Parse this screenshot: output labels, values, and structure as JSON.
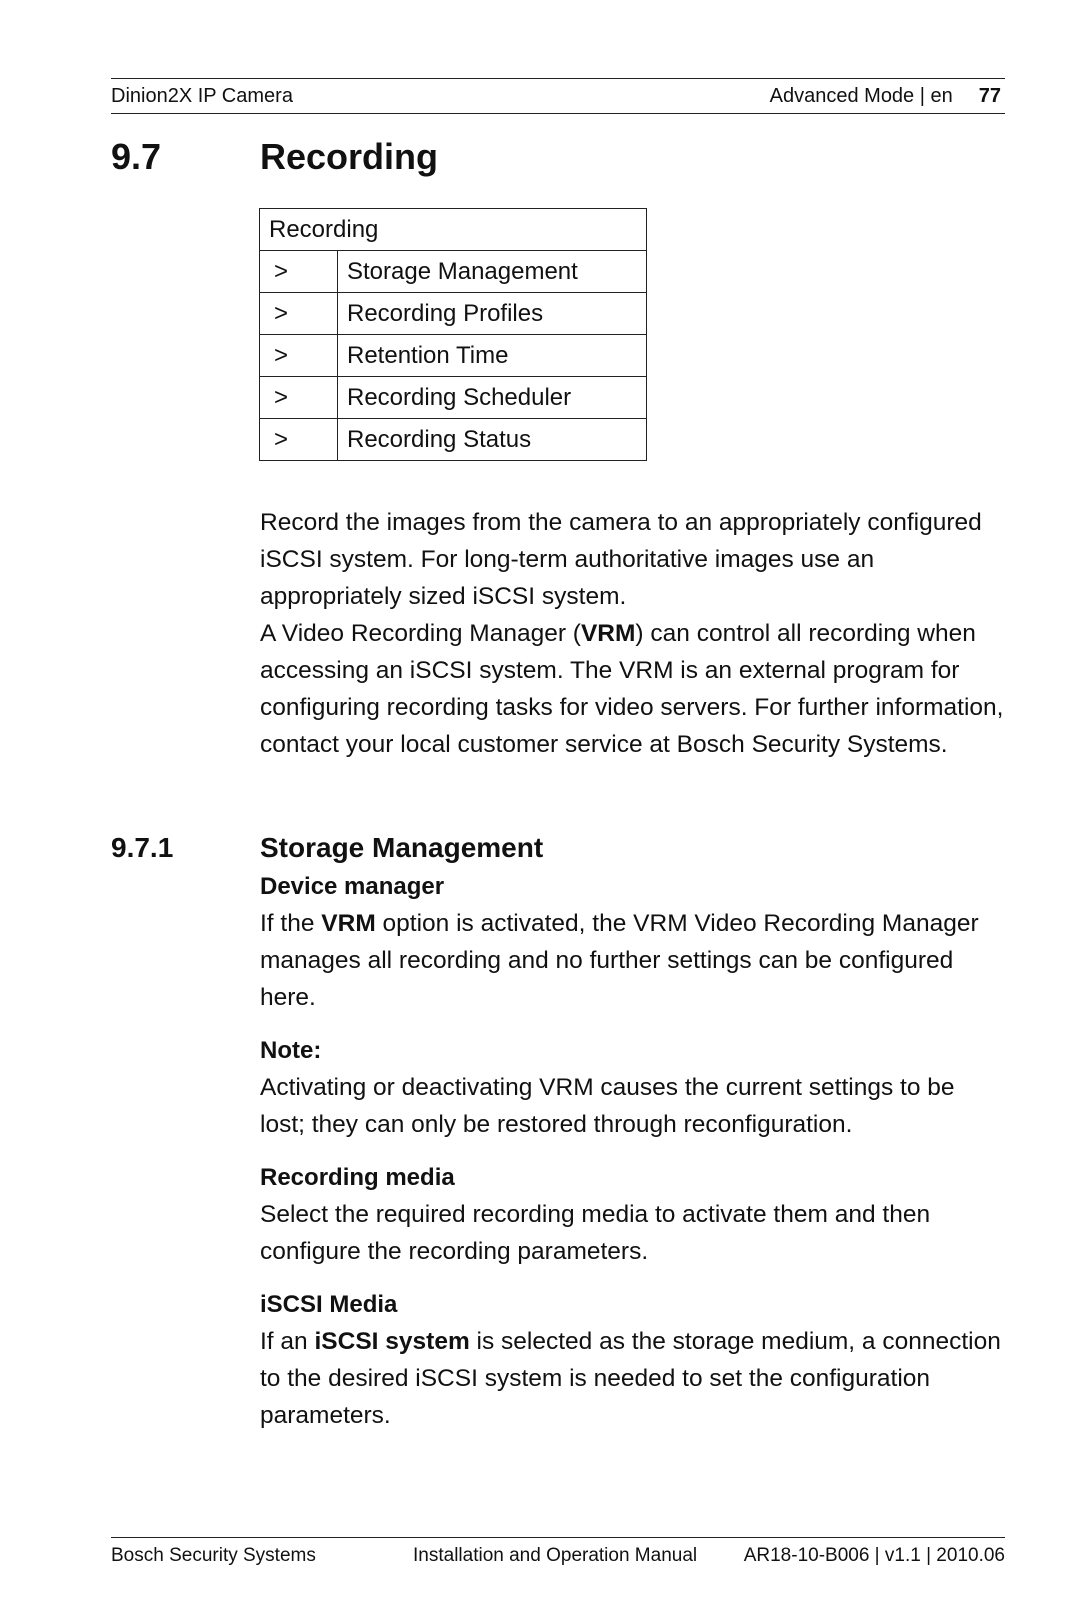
{
  "header": {
    "product": "Dinion2X IP Camera",
    "section": "Advanced Mode | en",
    "page_number": "77"
  },
  "section": {
    "number": "9.7",
    "title": "Recording"
  },
  "menu_table": {
    "header": "Recording",
    "rows": [
      {
        "arrow": ">",
        "label": "Storage Management"
      },
      {
        "arrow": ">",
        "label": "Recording Profiles"
      },
      {
        "arrow": ">",
        "label": "Retention Time"
      },
      {
        "arrow": ">",
        "label": "Recording Scheduler"
      },
      {
        "arrow": ">",
        "label": "Recording Status"
      }
    ]
  },
  "intro": {
    "p1": "Record the images from the camera to an appropriately configured iSCSI system. For long-term authoritative images use an appropriately sized iSCSI system.",
    "p2_before": "A Video Recording Manager (",
    "p2_bold": "VRM",
    "p2_after": ") can control all recording when accessing an iSCSI system. The VRM is an external program for configuring recording tasks for video servers. For further information, contact your local customer service at Bosch Security Systems."
  },
  "subsection": {
    "number": "9.7.1",
    "title": "Storage Management",
    "blocks": [
      {
        "heading": "Device manager",
        "text_before": "If the ",
        "text_bold": "VRM",
        "text_after": " option is activated, the VRM Video Recording Manager manages all recording and no further settings can be configured here."
      },
      {
        "heading": "Note:",
        "text_before": "Activating or deactivating VRM causes the current settings to be lost; they can only be restored through reconfiguration.",
        "text_bold": "",
        "text_after": ""
      },
      {
        "heading": "Recording media",
        "text_before": "Select the required recording media to activate them and then configure the recording parameters.",
        "text_bold": "",
        "text_after": ""
      },
      {
        "heading": "iSCSI Media",
        "text_before": "If an ",
        "text_bold": "iSCSI system",
        "text_after": " is selected as the storage medium, a connection to the desired iSCSI system is needed to set the configuration parameters."
      }
    ]
  },
  "footer": {
    "company": "Bosch Security Systems",
    "manual": "Installation and Operation Manual",
    "doc_id": "AR18-10-B006 | v1.1 | 2010.06"
  }
}
